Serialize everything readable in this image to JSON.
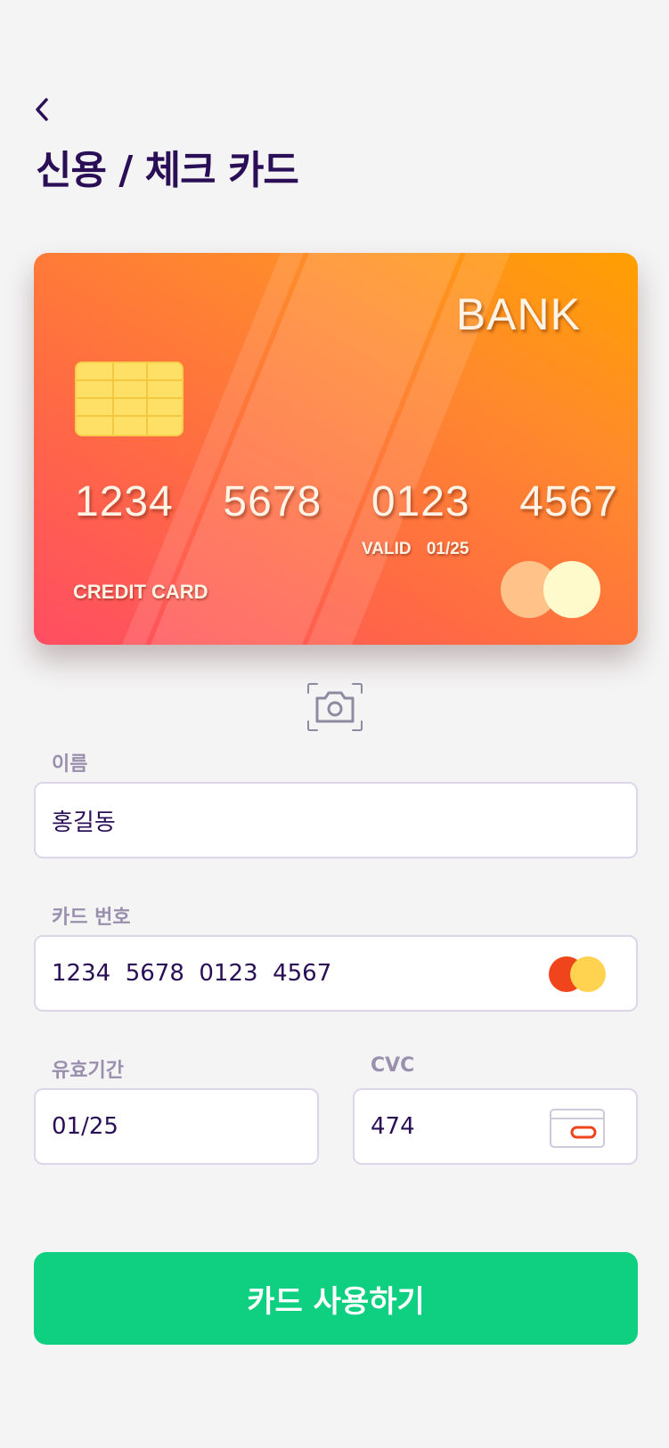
{
  "header": {
    "title": "신용 / 체크 카드"
  },
  "card": {
    "bank": "BANK",
    "number_groups": [
      "1234",
      "5678",
      "0123",
      "4567"
    ],
    "valid": "VALID 01/25",
    "type": "CREDIT CARD"
  },
  "form": {
    "name": {
      "label": "이름",
      "value": "홍길동"
    },
    "card_number": {
      "label": "카드 번호",
      "value": "1234  5678  0123  4567"
    },
    "expiry": {
      "label": "유효기간",
      "value": "01/25"
    },
    "cvc": {
      "label": "CVC",
      "value": "474"
    }
  },
  "submit": {
    "label": "카드 사용하기"
  },
  "colors": {
    "primary_text": "#2a0f57",
    "label": "#9b8fae",
    "button": "#0fcf80",
    "mastercard_red": "#f0441c",
    "mastercard_yellow": "#ffd24f"
  },
  "icons": [
    "back-arrow-icon",
    "camera-scan-icon",
    "mastercard-icon",
    "cvc-card-icon",
    "card-chip-icon"
  ]
}
